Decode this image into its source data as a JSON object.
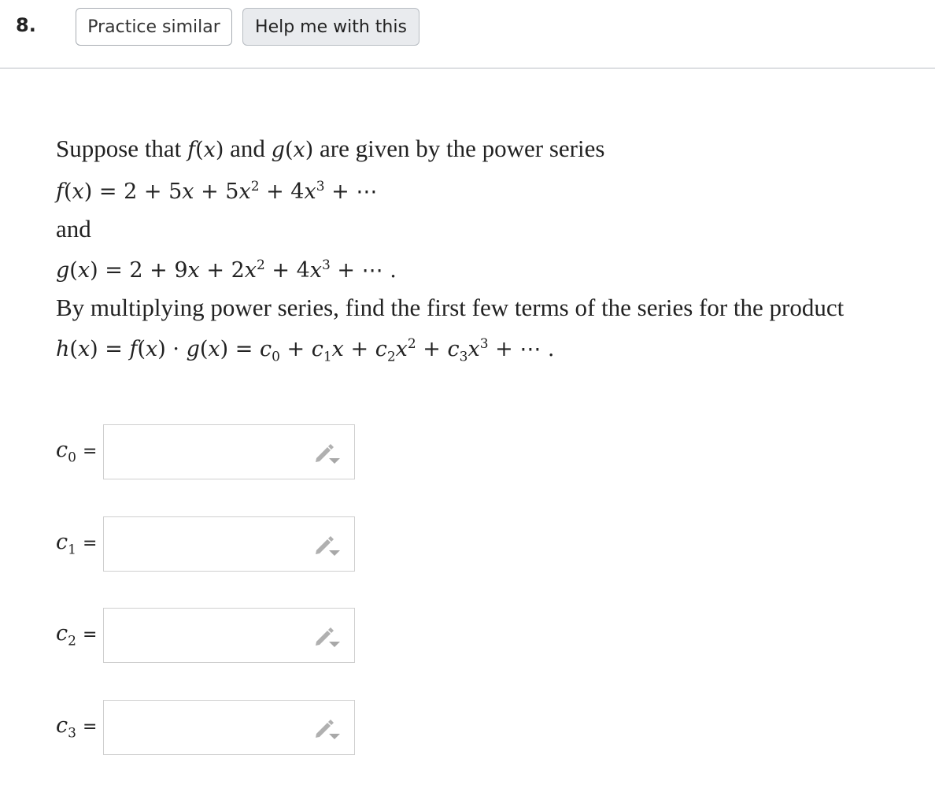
{
  "header": {
    "question_number": "8.",
    "practice_button": "Practice similar",
    "help_button": "Help me with this"
  },
  "problem": {
    "intro": "Suppose that f(x) and g(x) are given by the power series",
    "f_series": "f(x) = 2 + 5x + 5x² + 4x³ + ⋯",
    "and": "and",
    "g_series": "g(x) = 2 + 9x + 2x² + 4x³ + ⋯ .",
    "instruction": "By multiplying power series, find the first few terms of the series for the product",
    "h_series": "h(x) = f(x) · g(x) = c₀ + c₁x + c₂x² + c₃x³ + ⋯ ."
  },
  "answers": [
    {
      "label": "c",
      "subscript": "0",
      "equals": "=",
      "value": ""
    },
    {
      "label": "c",
      "subscript": "1",
      "equals": "=",
      "value": ""
    },
    {
      "label": "c",
      "subscript": "2",
      "equals": "=",
      "value": ""
    },
    {
      "label": "c",
      "subscript": "3",
      "equals": "=",
      "value": ""
    }
  ],
  "icons": {
    "input_tool": "pencil-dropdown-icon"
  },
  "colors": {
    "help_button_bg": "#e9ebee",
    "input_border": "#cfcfcf",
    "icon_gray": "#b0b0b0"
  }
}
